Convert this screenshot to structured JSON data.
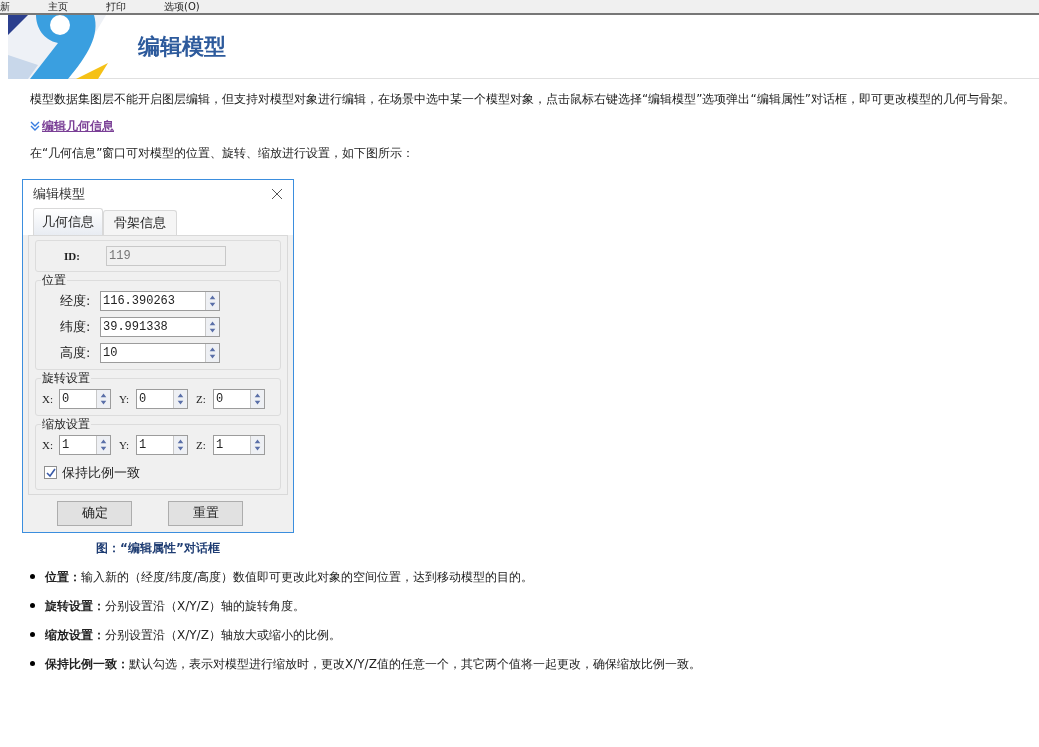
{
  "menu": [
    {
      "label": "新"
    },
    {
      "label": "主页"
    },
    {
      "label": "打印"
    },
    {
      "label": "选项(O)"
    }
  ],
  "header": {
    "title": "编辑模型"
  },
  "intro": "模型数据集图层不能开启图层编辑，但支持对模型对象进行编辑，在场景中选中某一个模型对象，点击鼠标右键选择“编辑模型”选项弹出“编辑属性”对话框，即可更改模型的几何与骨架。",
  "section_link": "编辑几何信息",
  "sub_intro": "在“几何信息”窗口可对模型的位置、旋转、缩放进行设置，如下图所示：",
  "dialog": {
    "title": "编辑模型",
    "tabs": [
      {
        "label": "几何信息",
        "selected": true
      },
      {
        "label": "骨架信息",
        "selected": false
      }
    ],
    "id_label": "ID:",
    "id_value": "119",
    "position": {
      "legend": "位置",
      "fields": [
        {
          "label": "经度:",
          "value": "116.390263"
        },
        {
          "label": "纬度:",
          "value": "39.991338"
        },
        {
          "label": "高度:",
          "value": "10"
        }
      ]
    },
    "rotation": {
      "legend": "旋转设置",
      "fields": [
        {
          "label": "X:",
          "value": "0"
        },
        {
          "label": "Y:",
          "value": "0"
        },
        {
          "label": "Z:",
          "value": "0"
        }
      ]
    },
    "scale": {
      "legend": "缩放设置",
      "fields": [
        {
          "label": "X:",
          "value": "1"
        },
        {
          "label": "Y:",
          "value": "1"
        },
        {
          "label": "Z:",
          "value": "1"
        }
      ],
      "keep_ratio": {
        "label": "保持比例一致",
        "checked": true
      }
    },
    "buttons": [
      "确定",
      "重置"
    ]
  },
  "caption": "图：“编辑属性”对话框",
  "bullets": [
    "**位置：**输入新的（经度/纬度/高度）数值即可更改此对象的空间位置，达到移动模型的目的。",
    "**旋转设置：**分别设置沿（X/Y/Z）轴的旋转角度。",
    "**缩放设置：**分别设置沿（X/Y/Z）轴放大或缩小的比例。",
    "**保持比例一致：**默认勾选，表示对模型进行缩放时，更改X/Y/Z值的任意一个，其它两个值将一起更改，确保缩放比例一致。"
  ]
}
